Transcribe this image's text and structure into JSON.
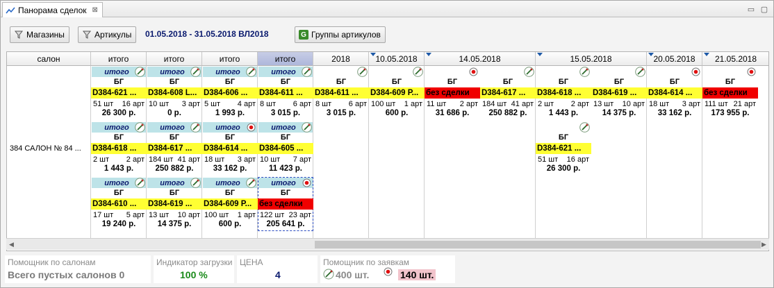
{
  "tab": {
    "title": "Панорама сделок"
  },
  "toolbar": {
    "stores_label": "Магазины",
    "articles_label": "Артикулы",
    "period": "01.05.2018 - 31.05.2018  ВЛ2018",
    "groups_label": "Группы артикулов",
    "groups_icon_letter": "G"
  },
  "grid": {
    "salon_header": "салон",
    "salon_name": "384 САЛОН № 84 ...",
    "headers": [
      {
        "label": "итого"
      },
      {
        "label": "итого"
      },
      {
        "label": "итого"
      },
      {
        "label": "итого"
      },
      {
        "label": "2018"
      },
      {
        "label": "10.05.2018"
      },
      {
        "label": "14.05.2018"
      },
      {
        "label": "15.05.2018"
      },
      {
        "label": "20.05.2018"
      },
      {
        "label": "21.05.2018"
      }
    ],
    "cells": [
      {
        "head": "итого",
        "icon": "pen",
        "bg": "БГ",
        "code": "D384-621 ...",
        "codeStyle": "yellow",
        "qty": "51 шт",
        "art": "16 арт",
        "sum": "26 300 р."
      },
      {
        "head": "итого",
        "icon": "pen",
        "bg": "БГ",
        "code": "D384-608 L...",
        "codeStyle": "yellow",
        "qty": "10 шт",
        "art": "3 арт",
        "sum": "0 р."
      },
      {
        "head": "итого",
        "icon": "pen",
        "bg": "БГ",
        "code": "D384-606 ...",
        "codeStyle": "yellow",
        "qty": "5 шт",
        "art": "4 арт",
        "sum": "1 993 р."
      },
      {
        "head": "итого",
        "icon": "pen",
        "bg": "БГ",
        "code": "D384-611 ...",
        "codeStyle": "yellow",
        "qty": "8 шт",
        "art": "6 арт",
        "sum": "3 015 р."
      },
      {
        "head": "итого",
        "icon": "pen",
        "bg": "БГ",
        "code": "D384-618 ...",
        "codeStyle": "yellow",
        "qty": "2 шт",
        "art": "2 арт",
        "sum": "1 443 р."
      },
      {
        "head": "итого",
        "icon": "pen",
        "bg": "БГ",
        "code": "D384-617 ...",
        "codeStyle": "yellow",
        "qty": "184 шт",
        "art": "41 арт",
        "sum": "250 882 р."
      },
      {
        "head": "итого",
        "icon": "dot",
        "bg": "БГ",
        "code": "D384-614 ...",
        "codeStyle": "yellow",
        "qty": "18 шт",
        "art": "3 арт",
        "sum": "33 162 р."
      },
      {
        "head": "итого",
        "icon": "pen",
        "bg": "БГ",
        "code": "D384-605 ...",
        "codeStyle": "yellow",
        "qty": "10 шт",
        "art": "7 арт",
        "sum": "11 423 р."
      },
      {
        "head": "итого",
        "icon": "pen",
        "bg": "БГ",
        "code": "D384-610 ...",
        "codeStyle": "yellow",
        "qty": "17 шт",
        "art": "5 арт",
        "sum": "19 240 р."
      },
      {
        "head": "итого",
        "icon": "pen",
        "bg": "БГ",
        "code": "D384-619 ...",
        "codeStyle": "yellow",
        "qty": "13 шт",
        "art": "10 арт",
        "sum": "14 375 р."
      },
      {
        "head": "итого",
        "icon": "pen",
        "bg": "БГ",
        "code": "D384-609 Р...",
        "codeStyle": "yellow",
        "qty": "100 шт",
        "art": "1 арт",
        "sum": "600 р."
      },
      {
        "head": "итого",
        "icon": "dot",
        "bg": "БГ",
        "code": "без сделки",
        "codeStyle": "red",
        "qty": "122 шт",
        "art": "23 арт",
        "sum": "205 641 р."
      },
      {
        "head": "",
        "icon": "pen",
        "bg": "БГ",
        "code": "D384-611 ...",
        "codeStyle": "yellow",
        "qty": "8 шт",
        "art": "6 арт",
        "sum": "3 015 р."
      },
      {
        "head": "",
        "icon": "pen",
        "bg": "БГ",
        "code": "D384-609 Р...",
        "codeStyle": "yellow",
        "qty": "100 шт",
        "art": "1 арт",
        "sum": "600 р."
      },
      {
        "head": "",
        "icon": "dot",
        "bg": "БГ",
        "code": "без сделки",
        "codeStyle": "red",
        "qty": "11 шт",
        "art": "2 арт",
        "sum": "31 686 р."
      },
      {
        "head": "",
        "icon": "pen",
        "bg": "БГ",
        "code": "D384-617 ...",
        "codeStyle": "yellow",
        "qty": "184 шт",
        "art": "41 арт",
        "sum": "250 882 р."
      },
      {
        "head": "",
        "icon": "pen",
        "bg": "БГ",
        "code": "D384-618 ...",
        "codeStyle": "yellow",
        "qty": "2 шт",
        "art": "2 арт",
        "sum": "1 443 р."
      },
      {
        "head": "",
        "icon": "pen",
        "bg": "БГ",
        "code": "D384-619 ...",
        "codeStyle": "yellow",
        "qty": "13 шт",
        "art": "10 арт",
        "sum": "14 375 р."
      },
      {
        "head": "",
        "icon": "dot",
        "bg": "БГ",
        "code": "D384-614 ...",
        "codeStyle": "yellow",
        "qty": "18 шт",
        "art": "3 арт",
        "sum": "33 162 р."
      },
      {
        "head": "",
        "icon": "dot",
        "bg": "БГ",
        "code": "без сделки",
        "codeStyle": "red",
        "qty": "111 шт",
        "art": "21 арт",
        "sum": "173 955 р."
      },
      {
        "head": "",
        "icon": "pen",
        "bg": "БГ",
        "code": "D384-621 ...",
        "codeStyle": "yellow",
        "qty": "51 шт",
        "art": "16 арт",
        "sum": "26 300 р."
      }
    ]
  },
  "panels": {
    "salon_helper_title": "Помощник по салонам",
    "salon_helper_value": "Всего пустых салонов 0",
    "load_title": "Индикатор загрузки",
    "load_value": "100 %",
    "price_title": "ЦЕНА",
    "price_value": "4",
    "orders_title": "Помощник по заявкам",
    "orders_pen_value": "400 шт.",
    "orders_dot_value": "140 шт."
  },
  "colors": {
    "yellow": "#ffff33",
    "red": "#f00000",
    "teal": "#bde3e8",
    "navy": "#0a1a6e",
    "green": "#1a8a1a",
    "pink": "#f2c4cc"
  }
}
